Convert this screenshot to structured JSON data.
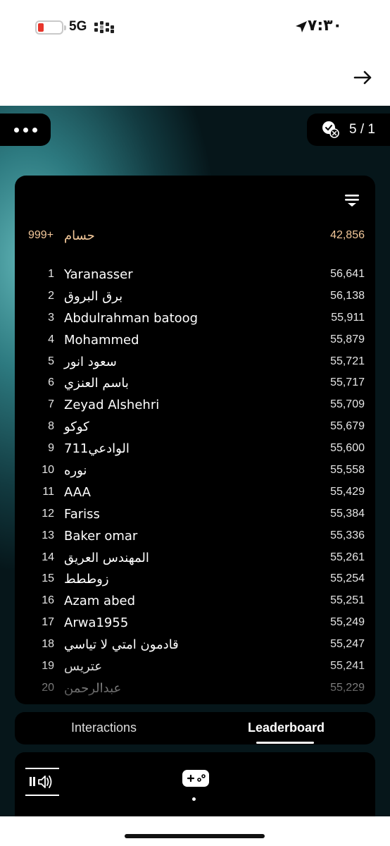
{
  "status_bar": {
    "network": "5G",
    "time": "٧:٣٠"
  },
  "pager": {
    "text": "5 / 1"
  },
  "leaderboard": {
    "current_user": {
      "rank": "999+",
      "name": "حسام",
      "score": "42,856"
    },
    "entries": [
      {
        "rank": "1",
        "name": "Yaranasser",
        "score": "56,641"
      },
      {
        "rank": "2",
        "name": "برق البروق",
        "score": "56,138"
      },
      {
        "rank": "3",
        "name": "Abdulrahman batoog",
        "score": "55,911"
      },
      {
        "rank": "4",
        "name": "Mohammed",
        "score": "55,879"
      },
      {
        "rank": "5",
        "name": "سعود انور",
        "score": "55,721"
      },
      {
        "rank": "6",
        "name": "باسم العنزي",
        "score": "55,717"
      },
      {
        "rank": "7",
        "name": "Zeyad Alshehri",
        "score": "55,709"
      },
      {
        "rank": "8",
        "name": "كوكو",
        "score": "55,679"
      },
      {
        "rank": "9",
        "name": "الوادعي711",
        "score": "55,600"
      },
      {
        "rank": "10",
        "name": "نوره",
        "score": "55,558"
      },
      {
        "rank": "11",
        "name": "AAA",
        "score": "55,429"
      },
      {
        "rank": "12",
        "name": "Fariss",
        "score": "55,384"
      },
      {
        "rank": "13",
        "name": "Baker omar",
        "score": "55,336"
      },
      {
        "rank": "14",
        "name": "المهندس العريق",
        "score": "55,261"
      },
      {
        "rank": "15",
        "name": "زوططط",
        "score": "55,254"
      },
      {
        "rank": "16",
        "name": "Azam abed",
        "score": "55,251"
      },
      {
        "rank": "17",
        "name": "Arwa1955",
        "score": "55,249"
      },
      {
        "rank": "18",
        "name": "قادمون امتي لا تياسي",
        "score": "55,247"
      },
      {
        "rank": "19",
        "name": "عتريس",
        "score": "55,241"
      },
      {
        "rank": "20",
        "name": "عبدالرحمن",
        "score": "55,229"
      }
    ]
  },
  "tabs": {
    "interactions": "Interactions",
    "leaderboard": "Leaderboard",
    "active": "leaderboard"
  },
  "icons": {
    "forward": "arrow-right-icon",
    "more": "more-dots-icon",
    "pager": "check-x-badge-icon",
    "filter": "filter-icon",
    "audio": "pause-volume-icon",
    "game": "gamepad-icon"
  },
  "colors": {
    "highlight": "#f3c89a",
    "battery_low": "#e8362c",
    "panel": "#000000"
  }
}
